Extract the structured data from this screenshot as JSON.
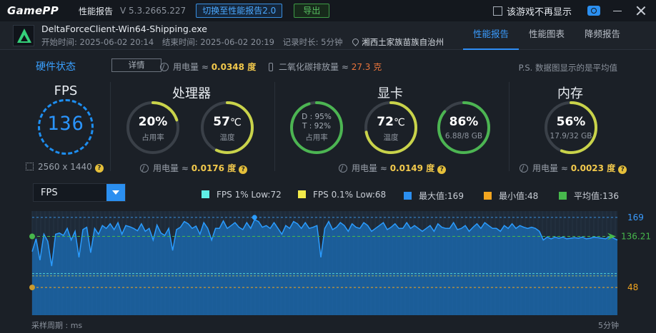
{
  "titlebar": {
    "logo": "GamePP",
    "title": "性能报告",
    "version": "V 5.3.2665.227",
    "switch_button": "切换至性能报告2.0",
    "export_button": "导出",
    "no_show_label": "该游戏不再显示"
  },
  "process": {
    "name": "DeltaForceClient-Win64-Shipping.exe",
    "start": "开始时间: 2025-06-02 20:14",
    "end": "结束时间: 2025-06-02 20:19",
    "duration": "记录时长: 5分钟",
    "location": "湘西土家族苗族自治州"
  },
  "tabs": [
    "性能报告",
    "性能图表",
    "降频报告"
  ],
  "hardware": {
    "title": "硬件状态",
    "detail_button": "详情",
    "power_label": "用电量 ≈",
    "power_value": "0.0348 度",
    "co2_label": "二氧化碳排放量 ≈",
    "co2_value": "27.3 克",
    "note": "P.S. 数据图显示的是平均值"
  },
  "fps": {
    "title": "FPS",
    "value": "136",
    "resolution": "2560 x 1440"
  },
  "cpu": {
    "title": "处理器",
    "usage": "20%",
    "usage_label": "占用率",
    "usage_fraction": 0.2,
    "temp": "57",
    "temp_unit": "℃",
    "temp_label": "温度",
    "temp_fraction": 0.57,
    "power_label": "用电量 ≈",
    "power_value": "0.0176 度"
  },
  "gpu": {
    "title": "显卡",
    "d_line": "D : 95%",
    "t_line": "T : 92%",
    "usage_label": "占用率",
    "usage_fraction": 0.95,
    "temp": "72",
    "temp_unit": "℃",
    "temp_label": "温度",
    "temp_fraction": 0.72,
    "mem": "86%",
    "mem_detail": "6.88/8 GB",
    "mem_fraction": 0.86,
    "power_label": "用电量 ≈",
    "power_value": "0.0149 度"
  },
  "memory": {
    "title": "内存",
    "usage": "56%",
    "detail": "17.9/32 GB",
    "usage_fraction": 0.56,
    "power_label": "用电量 ≈",
    "power_value": "0.0023 度"
  },
  "chart_header": {
    "select_value": "FPS",
    "legend": [
      {
        "label": "FPS 1% Low:72",
        "color": "#5ff0e6"
      },
      {
        "label": "FPS 0.1% Low:68",
        "color": "#f2ea4a"
      },
      {
        "label": "最大值:169",
        "color": "#2b8ff0"
      },
      {
        "label": "最小值:48",
        "color": "#f2a51f"
      },
      {
        "label": "平均值:136",
        "color": "#47b84c"
      }
    ]
  },
  "chart_data": {
    "type": "area",
    "ylim": [
      0,
      180
    ],
    "max": 169,
    "min": 48,
    "avg": 136.21,
    "low1": 72,
    "low01": 68,
    "max_label": "169",
    "avg_label": "136.21",
    "min_label": "48",
    "series": [
      {
        "values": [
          110,
          132,
          95,
          140,
          128,
          85,
          140,
          142,
          138,
          150,
          130,
          145,
          100,
          148,
          152,
          108,
          150,
          140,
          155,
          150,
          158,
          148,
          160,
          140,
          155,
          153,
          150,
          146,
          158,
          145,
          150,
          130,
          156,
          142,
          138,
          150,
          112,
          148,
          152,
          162,
          158,
          150,
          154,
          140,
          160,
          150,
          130,
          150,
          150,
          163,
          150,
          155,
          160,
          152,
          148,
          160,
          150,
          165,
          162,
          152,
          155,
          150,
          160,
          150,
          140,
          155,
          150,
          162,
          158,
          150,
          160,
          150,
          152,
          155,
          100,
          150,
          162,
          148,
          152,
          160,
          155,
          145,
          158,
          152,
          150,
          160,
          155,
          145,
          150,
          155,
          160,
          148,
          152,
          158,
          150,
          150,
          160,
          150,
          155,
          150,
          145,
          150,
          155,
          145,
          158,
          152,
          150,
          150,
          160,
          148,
          150,
          155,
          145,
          152,
          158,
          150,
          160,
          155,
          150,
          150,
          145,
          155,
          150,
          158,
          150,
          155,
          152,
          150,
          152,
          150,
          145,
          130,
          135,
          132,
          135,
          133,
          135,
          132,
          133,
          134,
          133,
          135,
          132,
          133,
          135,
          134,
          133,
          132,
          136,
          133,
          130
        ]
      }
    ],
    "xlabel": "采样周期 : ms",
    "x_end_label": "5分钟"
  }
}
